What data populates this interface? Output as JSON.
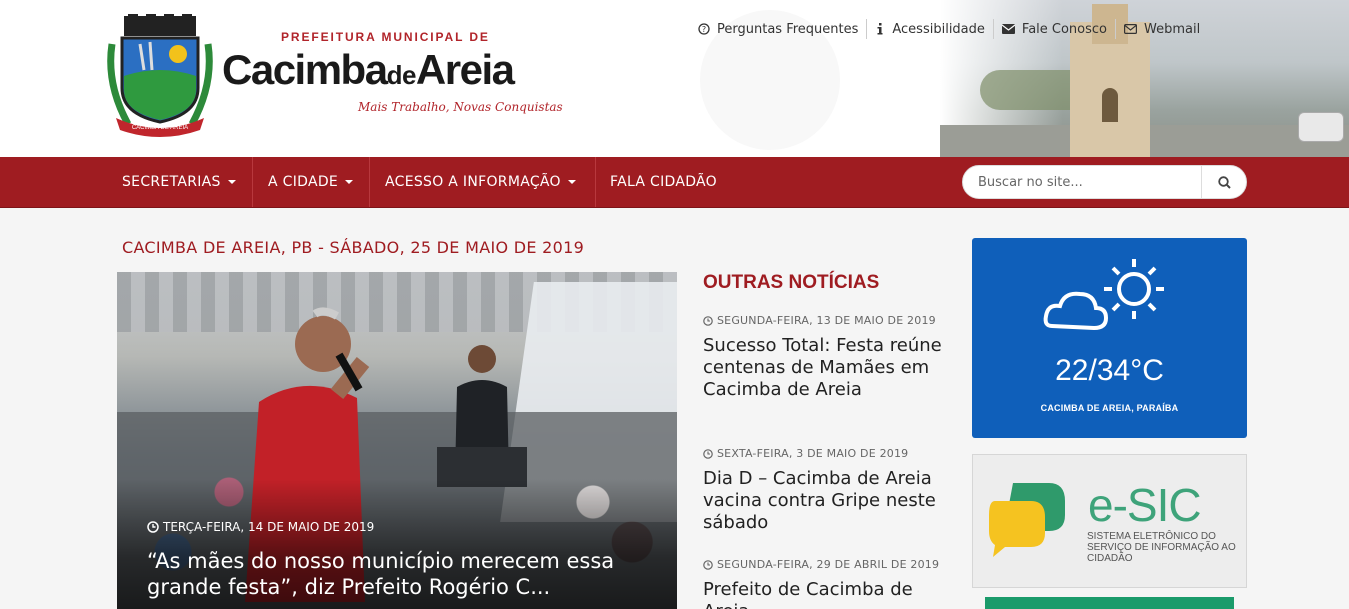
{
  "header": {
    "logo_small": "PREFEITURA MUNICIPAL DE",
    "logo_main_1": "Cacimba",
    "logo_main_de": "de",
    "logo_main_2": "Areia",
    "tagline": "Mais Trabalho, Novas Conquistas",
    "crest_ribbon": "CACIMBA DE AREIA"
  },
  "toplinks": [
    {
      "label": "Perguntas Frequentes",
      "icon": "question-circle-icon"
    },
    {
      "label": "Acessibilidade",
      "icon": "info-icon"
    },
    {
      "label": "Fale Conosco",
      "icon": "envelope-icon"
    },
    {
      "label": "Webmail",
      "icon": "envelope-outline-icon"
    }
  ],
  "nav": {
    "items": [
      {
        "label": "SECRETARIAS",
        "dropdown": true
      },
      {
        "label": "A CIDADE",
        "dropdown": true
      },
      {
        "label": "ACESSO A INFORMAÇÃO",
        "dropdown": true
      },
      {
        "label": "FALA CIDADÃO",
        "dropdown": false
      }
    ],
    "search_placeholder": "Buscar no site..."
  },
  "dateline": "CACIMBA DE AREIA, PB - SÁBADO, 25 DE MAIO DE 2019",
  "feature": {
    "date": "TERÇA-FEIRA, 14 DE MAIO DE 2019",
    "title": "“As mães do nosso município merecem essa grande festa”, diz Prefeito Rogério C..."
  },
  "other_news": {
    "heading": "OUTRAS NOTÍCIAS",
    "items": [
      {
        "date": "SEGUNDA-FEIRA, 13 DE MAIO DE 2019",
        "title": "Sucesso Total: Festa reúne centenas de Mamães em Cacimba de Areia"
      },
      {
        "date": "SEXTA-FEIRA, 3 DE MAIO DE 2019",
        "title": "Dia D – Cacimba de Areia vacina contra Gripe neste sábado"
      },
      {
        "date": "SEGUNDA-FEIRA, 29 DE ABRIL DE 2019",
        "title": "Prefeito de Cacimba de Areia"
      }
    ]
  },
  "weather": {
    "temperature": "22/34°C",
    "location": "CACIMBA DE AREIA, PARAÍBA",
    "icon": "partly-cloudy-icon"
  },
  "esic": {
    "title": "e-SIC",
    "subtitle": "SISTEMA ELETRÔNICO DO SERVIÇO DE INFORMAÇÃO AO CIDADÃO"
  },
  "colors": {
    "brand_red": "#9f1c21",
    "weather_blue": "#0f5fba",
    "esic_green": "#3ea37a"
  }
}
